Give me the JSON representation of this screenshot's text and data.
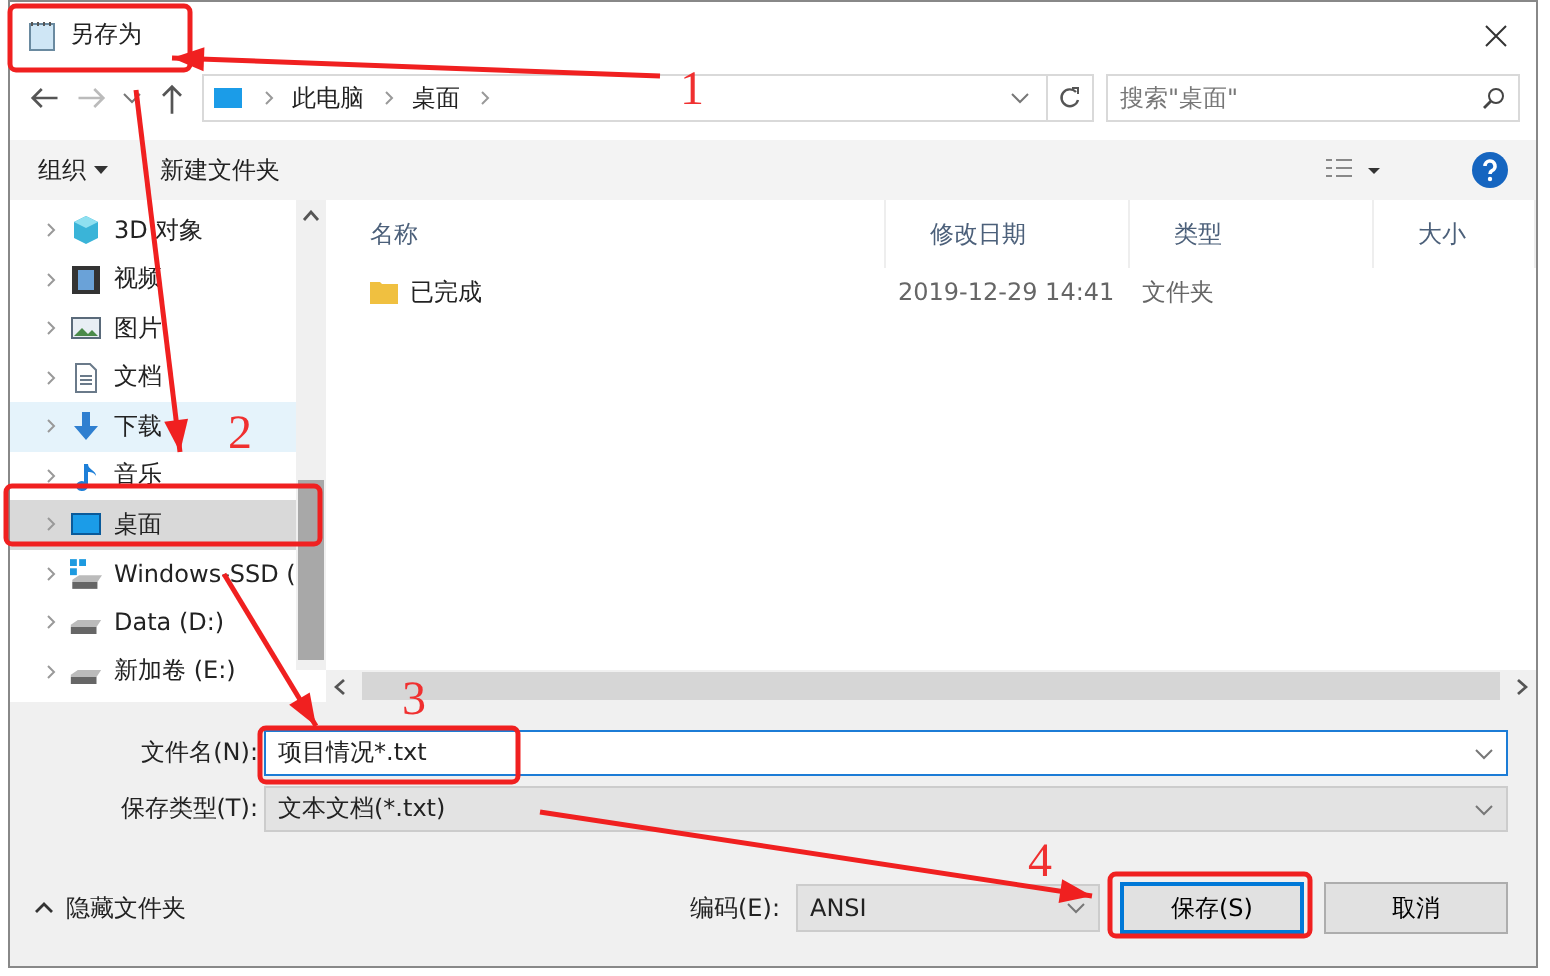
{
  "window": {
    "title": "另存为"
  },
  "nav": {
    "path": [
      "此电脑",
      "桌面"
    ],
    "search_placeholder": "搜索\"桌面\""
  },
  "toolbar": {
    "organize": "组织",
    "new_folder": "新建文件夹"
  },
  "sidebar": {
    "items": [
      {
        "label": "3D 对象",
        "kind": "cube",
        "selected": false,
        "hovered": false
      },
      {
        "label": "视频",
        "kind": "video",
        "selected": false,
        "hovered": false
      },
      {
        "label": "图片",
        "kind": "picture",
        "selected": false,
        "hovered": false
      },
      {
        "label": "文档",
        "kind": "document",
        "selected": false,
        "hovered": false
      },
      {
        "label": "下载",
        "kind": "download",
        "selected": false,
        "hovered": true
      },
      {
        "label": "音乐",
        "kind": "music",
        "selected": false,
        "hovered": false
      },
      {
        "label": "桌面",
        "kind": "desktop",
        "selected": true,
        "hovered": false
      },
      {
        "label": "Windows-SSD (",
        "kind": "system-drive",
        "selected": false,
        "hovered": false
      },
      {
        "label": "Data (D:)",
        "kind": "drive",
        "selected": false,
        "hovered": false
      },
      {
        "label": "新加卷 (E:)",
        "kind": "drive",
        "selected": false,
        "hovered": false
      }
    ]
  },
  "table": {
    "columns": [
      "名称",
      "修改日期",
      "类型",
      "大小"
    ],
    "rows": [
      {
        "name": "已完成",
        "modified": "2019-12-29 14:41",
        "type": "文件夹"
      }
    ]
  },
  "form": {
    "filename_label": "文件名(N):",
    "filename": "项目情况*.txt",
    "type_label": "保存类型(T):",
    "type": "文本文档(*.txt)",
    "encoding_label": "编码(E):",
    "encoding": "ANSI"
  },
  "hide_folders": "隐藏文件夹",
  "buttons": [
    "保存(S)",
    "取消"
  ],
  "annotations": [
    {
      "number": "1"
    },
    {
      "number": "2"
    },
    {
      "number": "3"
    },
    {
      "number": "4"
    }
  ]
}
